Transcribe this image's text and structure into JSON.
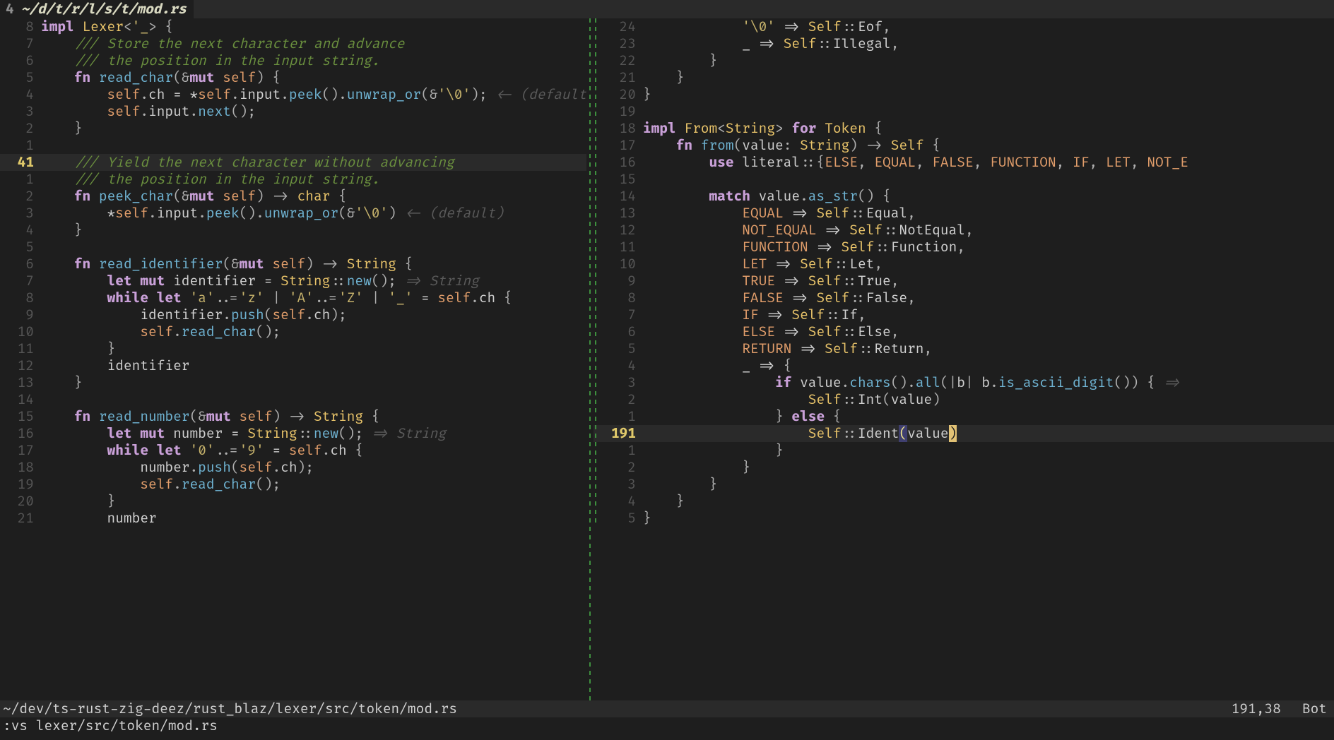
{
  "tab": {
    "index": "4",
    "title": "~/d/t/r/l/s/t/mod.rs"
  },
  "status": {
    "path": "~/dev/ts-rust-zig-deez/rust_blaz/lexer/src/token/mod.rs",
    "ruler": "191,38",
    "pos": "Bot"
  },
  "cmdline": ":vs lexer/src/token/mod.rs",
  "left": {
    "lines": [
      {
        "num": "8",
        "html": "<span class='kw'>impl</span> <span class='ty'>Lexer</span><span class='punct'>&lt;</span><span class='char'>'_</span><span class='punct'>&gt;</span> <span class='punct'>{</span>"
      },
      {
        "num": "7",
        "html": "    <span class='comment'>/// Store the next character and advance</span>"
      },
      {
        "num": "6",
        "html": "    <span class='comment'>/// the position in the input string.</span>"
      },
      {
        "num": "5",
        "html": "    <span class='kw'>fn</span> <span class='fnname'>read_char</span><span class='punct'>(&amp;</span><span class='kw'>mut</span> <span class='self'>self</span><span class='punct'>)</span> <span class='punct'>{</span>"
      },
      {
        "num": "4",
        "html": "        <span class='self'>self</span><span class='punct'>.</span><span class='ident'>ch</span> <span class='op'>=</span> <span class='op'>*</span><span class='self'>self</span><span class='punct'>.</span><span class='ident'>input</span><span class='punct'>.</span><span class='method'>peek</span><span class='punct'>()</span><span class='punct'>.</span><span class='method'>unwrap_or</span><span class='punct'>(&amp;</span><span class='char'>'\\0'</span><span class='punct'>);</span> <span class='hint'>&lt;- (default</span>"
      },
      {
        "num": "3",
        "html": "        <span class='self'>self</span><span class='punct'>.</span><span class='ident'>input</span><span class='punct'>.</span><span class='method'>next</span><span class='punct'>();</span>"
      },
      {
        "num": "2",
        "html": "    <span class='punct'>}</span>"
      },
      {
        "num": "1",
        "html": ""
      },
      {
        "num": "41",
        "cur": true,
        "html": "    <span class='comment'>/// Yield the next character without advancing</span>"
      },
      {
        "num": "1",
        "html": "    <span class='comment'>/// the position in the input string.</span>"
      },
      {
        "num": "2",
        "html": "    <span class='kw'>fn</span> <span class='fnname'>peek_char</span><span class='punct'>(&amp;</span><span class='kw'>mut</span> <span class='self'>self</span><span class='punct'>)</span> <span class='punct'>-&gt;</span> <span class='ty'>char</span> <span class='punct'>{</span>"
      },
      {
        "num": "3",
        "html": "        <span class='op'>*</span><span class='self'>self</span><span class='punct'>.</span><span class='ident'>input</span><span class='punct'>.</span><span class='method'>peek</span><span class='punct'>()</span><span class='punct'>.</span><span class='method'>unwrap_or</span><span class='punct'>(&amp;</span><span class='char'>'\\0'</span><span class='punct'>)</span> <span class='hint'>&lt;- (default)</span>"
      },
      {
        "num": "4",
        "html": "    <span class='punct'>}</span>"
      },
      {
        "num": "5",
        "html": ""
      },
      {
        "num": "6",
        "html": "    <span class='kw'>fn</span> <span class='fnname'>read_identifier</span><span class='punct'>(&amp;</span><span class='kw'>mut</span> <span class='self'>self</span><span class='punct'>)</span> <span class='punct'>-&gt;</span> <span class='ty'>String</span> <span class='punct'>{</span>"
      },
      {
        "num": "7",
        "html": "        <span class='kw'>let</span> <span class='kw'>mut</span> <span class='ident'>identifier</span> <span class='op'>=</span> <span class='ty'>String</span><span class='punct'>::</span><span class='method'>new</span><span class='punct'>();</span> <span class='hint'>=&gt; String</span>"
      },
      {
        "num": "8",
        "html": "        <span class='kw'>while</span> <span class='kw'>let</span> <span class='char'>'a'</span><span class='punct'>..=</span><span class='char'>'z'</span> <span class='punct'>|</span> <span class='char'>'A'</span><span class='punct'>..=</span><span class='char'>'Z'</span> <span class='punct'>|</span> <span class='char'>'_'</span> <span class='op'>=</span> <span class='self'>self</span><span class='punct'>.</span><span class='ident'>ch</span> <span class='punct'>{</span>"
      },
      {
        "num": "9",
        "html": "            <span class='ident'>identifier</span><span class='punct'>.</span><span class='method'>push</span><span class='punct'>(</span><span class='self'>self</span><span class='punct'>.</span><span class='ident'>ch</span><span class='punct'>);</span>"
      },
      {
        "num": "10",
        "html": "            <span class='self'>self</span><span class='punct'>.</span><span class='method'>read_char</span><span class='punct'>();</span>"
      },
      {
        "num": "11",
        "html": "        <span class='punct'>}</span>"
      },
      {
        "num": "12",
        "html": "        <span class='ident'>identifier</span>"
      },
      {
        "num": "13",
        "html": "    <span class='punct'>}</span>"
      },
      {
        "num": "14",
        "html": ""
      },
      {
        "num": "15",
        "html": "    <span class='kw'>fn</span> <span class='fnname'>read_number</span><span class='punct'>(&amp;</span><span class='kw'>mut</span> <span class='self'>self</span><span class='punct'>)</span> <span class='punct'>-&gt;</span> <span class='ty'>String</span> <span class='punct'>{</span>"
      },
      {
        "num": "16",
        "html": "        <span class='kw'>let</span> <span class='kw'>mut</span> <span class='ident'>number</span> <span class='op'>=</span> <span class='ty'>String</span><span class='punct'>::</span><span class='method'>new</span><span class='punct'>();</span> <span class='hint'>=&gt; String</span>"
      },
      {
        "num": "17",
        "html": "        <span class='kw'>while</span> <span class='kw'>let</span> <span class='char'>'0'</span><span class='punct'>..=</span><span class='char'>'9'</span> <span class='op'>=</span> <span class='self'>self</span><span class='punct'>.</span><span class='ident'>ch</span> <span class='punct'>{</span>"
      },
      {
        "num": "18",
        "html": "            <span class='ident'>number</span><span class='punct'>.</span><span class='method'>push</span><span class='punct'>(</span><span class='self'>self</span><span class='punct'>.</span><span class='ident'>ch</span><span class='punct'>);</span>"
      },
      {
        "num": "19",
        "html": "            <span class='self'>self</span><span class='punct'>.</span><span class='method'>read_char</span><span class='punct'>();</span>"
      },
      {
        "num": "20",
        "html": "        <span class='punct'>}</span>"
      },
      {
        "num": "21",
        "html": "        <span class='ident'>number</span>"
      }
    ]
  },
  "right": {
    "lines": [
      {
        "num": "24",
        "html": "            <span class='char'>'\\0'</span> <span class='op'>=&gt;</span> <span class='ty'>Self</span><span class='punct'>::</span><span class='ident'>Eof</span><span class='punct'>,</span>"
      },
      {
        "num": "23",
        "html": "            <span class='ident'>_</span> <span class='op'>=&gt;</span> <span class='ty'>Self</span><span class='punct'>::</span><span class='ident'>Illegal</span><span class='punct'>,</span>"
      },
      {
        "num": "22",
        "html": "        <span class='punct'>}</span>"
      },
      {
        "num": "21",
        "html": "    <span class='punct'>}</span>"
      },
      {
        "num": "20",
        "html": "<span class='punct'>}</span>"
      },
      {
        "num": "19",
        "html": ""
      },
      {
        "num": "18",
        "html": "<span class='kw'>impl</span> <span class='ty'>From</span><span class='punct'>&lt;</span><span class='ty'>String</span><span class='punct'>&gt;</span> <span class='kw'>for</span> <span class='ty'>Token</span> <span class='punct'>{</span>"
      },
      {
        "num": "17",
        "html": "    <span class='kw'>fn</span> <span class='fnname'>from</span><span class='punct'>(</span><span class='ident'>value</span><span class='punct'>:</span> <span class='ty'>String</span><span class='punct'>)</span> <span class='punct'>-&gt;</span> <span class='ty'>Self</span> <span class='punct'>{</span>"
      },
      {
        "num": "16",
        "html": "        <span class='kw'>use</span> <span class='ident'>literal</span><span class='punct'>::{</span><span class='const'>ELSE</span><span class='punct'>,</span> <span class='const'>EQUAL</span><span class='punct'>,</span> <span class='const'>FALSE</span><span class='punct'>,</span> <span class='const'>FUNCTION</span><span class='punct'>,</span> <span class='const'>IF</span><span class='punct'>,</span> <span class='const'>LET</span><span class='punct'>,</span> <span class='const'>NOT_E</span>"
      },
      {
        "num": "15",
        "html": ""
      },
      {
        "num": "14",
        "html": "        <span class='kw'>match</span> <span class='ident'>value</span><span class='punct'>.</span><span class='method'>as_str</span><span class='punct'>()</span> <span class='punct'>{</span>"
      },
      {
        "num": "13",
        "html": "            <span class='const'>EQUAL</span> <span class='op'>=&gt;</span> <span class='ty'>Self</span><span class='punct'>::</span><span class='ident'>Equal</span><span class='punct'>,</span>"
      },
      {
        "num": "12",
        "html": "            <span class='const'>NOT_EQUAL</span> <span class='op'>=&gt;</span> <span class='ty'>Self</span><span class='punct'>::</span><span class='ident'>NotEqual</span><span class='punct'>,</span>"
      },
      {
        "num": "11",
        "html": "            <span class='const'>FUNCTION</span> <span class='op'>=&gt;</span> <span class='ty'>Self</span><span class='punct'>::</span><span class='ident'>Function</span><span class='punct'>,</span>"
      },
      {
        "num": "10",
        "html": "            <span class='const'>LET</span> <span class='op'>=&gt;</span> <span class='ty'>Self</span><span class='punct'>::</span><span class='ident'>Let</span><span class='punct'>,</span>"
      },
      {
        "num": "9",
        "html": "            <span class='const'>TRUE</span> <span class='op'>=&gt;</span> <span class='ty'>Self</span><span class='punct'>::</span><span class='ident'>True</span><span class='punct'>,</span>"
      },
      {
        "num": "8",
        "html": "            <span class='const'>FALSE</span> <span class='op'>=&gt;</span> <span class='ty'>Self</span><span class='punct'>::</span><span class='ident'>False</span><span class='punct'>,</span>"
      },
      {
        "num": "7",
        "html": "            <span class='const'>IF</span> <span class='op'>=&gt;</span> <span class='ty'>Self</span><span class='punct'>::</span><span class='ident'>If</span><span class='punct'>,</span>"
      },
      {
        "num": "6",
        "html": "            <span class='const'>ELSE</span> <span class='op'>=&gt;</span> <span class='ty'>Self</span><span class='punct'>::</span><span class='ident'>Else</span><span class='punct'>,</span>"
      },
      {
        "num": "5",
        "html": "            <span class='const'>RETURN</span> <span class='op'>=&gt;</span> <span class='ty'>Self</span><span class='punct'>::</span><span class='ident'>Return</span><span class='punct'>,</span>"
      },
      {
        "num": "4",
        "html": "            <span class='ident'>_</span> <span class='op'>=&gt;</span> <span class='punct'>{</span>"
      },
      {
        "num": "3",
        "html": "                <span class='kw'>if</span> <span class='ident'>value</span><span class='punct'>.</span><span class='method'>chars</span><span class='punct'>()</span><span class='punct'>.</span><span class='method'>all</span><span class='punct'>(|</span><span class='ident'>b</span><span class='punct'>|</span> <span class='ident'>b</span><span class='punct'>.</span><span class='method'>is_ascii_digit</span><span class='punct'>())</span> <span class='punct'>{</span> <span class='hint'>=&gt;</span>"
      },
      {
        "num": "2",
        "html": "                    <span class='ty'>Self</span><span class='punct'>::</span><span class='ident'>Int</span><span class='punct'>(</span><span class='ident'>value</span><span class='punct'>)</span>"
      },
      {
        "num": "1",
        "html": "                <span class='punct'>}</span> <span class='kw'>else</span> <span class='punct'>{</span>"
      },
      {
        "num": "191",
        "cur": true,
        "html": "                    <span class='ty'>Self</span><span class='punct'>::</span><span class='ident'>Ident</span><span class='matchbr-a'>(</span><span class='ident'>value</span><span class='matchbr-b'>)</span>"
      },
      {
        "num": "1",
        "html": "                <span class='punct'>}</span>"
      },
      {
        "num": "2",
        "html": "            <span class='punct'>}</span>"
      },
      {
        "num": "3",
        "html": "        <span class='punct'>}</span>"
      },
      {
        "num": "4",
        "html": "    <span class='punct'>}</span>"
      },
      {
        "num": "5",
        "html": "<span class='punct'>}</span>"
      }
    ]
  }
}
